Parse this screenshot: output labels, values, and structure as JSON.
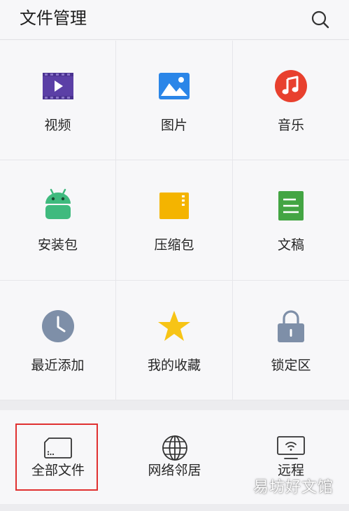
{
  "header": {
    "title": "文件管理",
    "search_icon": "search-icon"
  },
  "grid": {
    "items": [
      {
        "label": "视频",
        "icon": "video-icon",
        "color": "#5b3fa6"
      },
      {
        "label": "图片",
        "icon": "image-icon",
        "color": "#2b86e8"
      },
      {
        "label": "音乐",
        "icon": "music-icon",
        "color": "#e8402e"
      },
      {
        "label": "安装包",
        "icon": "android-icon",
        "color": "#3fba7e"
      },
      {
        "label": "压缩包",
        "icon": "archive-icon",
        "color": "#f4b400"
      },
      {
        "label": "文稿",
        "icon": "document-icon",
        "color": "#43a543"
      },
      {
        "label": "最近添加",
        "icon": "clock-icon",
        "color": "#7e8fa8"
      },
      {
        "label": "我的收藏",
        "icon": "star-icon",
        "color": "#f7c416"
      },
      {
        "label": "锁定区",
        "icon": "lock-icon",
        "color": "#7e8fa8"
      }
    ]
  },
  "bottom": {
    "items": [
      {
        "label": "全部文件",
        "icon": "storage-icon"
      },
      {
        "label": "网络邻居",
        "icon": "globe-icon"
      },
      {
        "label": "远程",
        "icon": "remote-screen-icon"
      }
    ]
  },
  "watermark": "易坊好文馆"
}
